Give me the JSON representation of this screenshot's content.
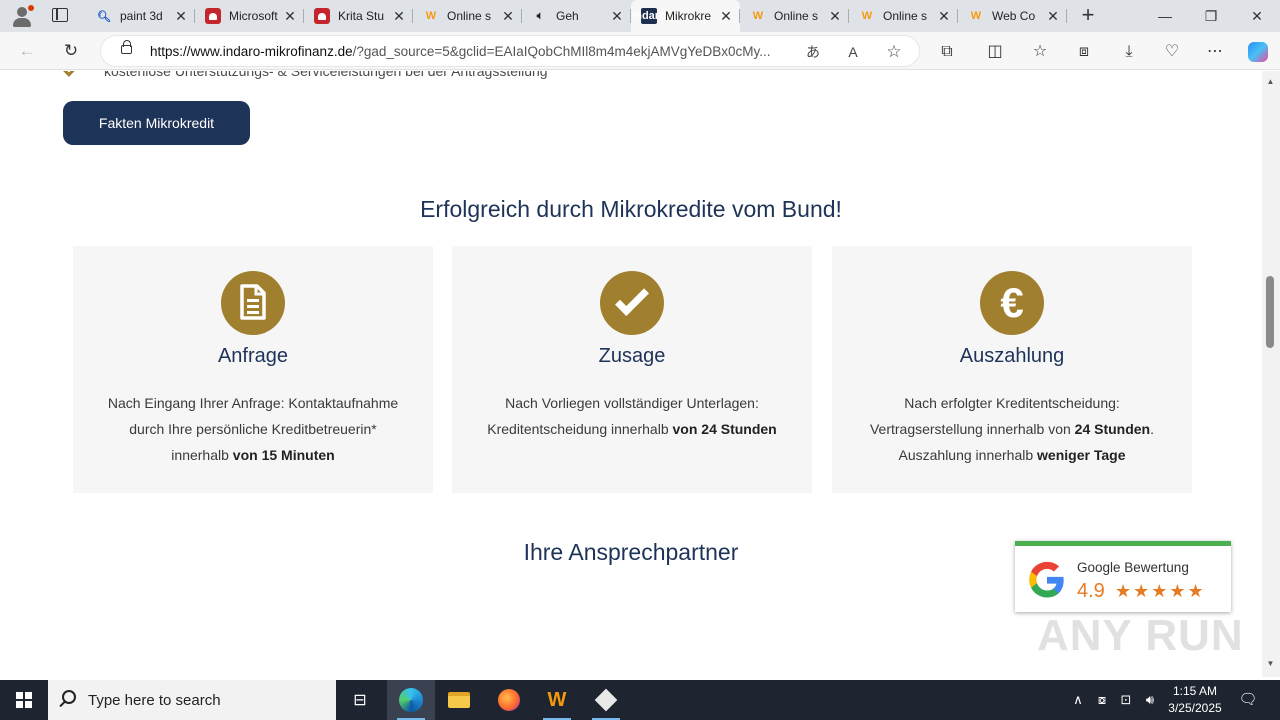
{
  "browser": {
    "tabs": [
      {
        "label": "paint 3d",
        "icon": "search-icon"
      },
      {
        "label": "Microsoft",
        "icon": "app-icon"
      },
      {
        "label": "Krita Stu",
        "icon": "app-icon"
      },
      {
        "label": "Online s",
        "icon": "wix-icon"
      },
      {
        "label": "Geh",
        "icon": "speaker-icon"
      },
      {
        "label": "Mikrokre",
        "icon": "indaro-icon",
        "active": true
      },
      {
        "label": "Online s",
        "icon": "wix-icon"
      },
      {
        "label": "Online s",
        "icon": "wix-icon"
      },
      {
        "label": "Web Co",
        "icon": "wix-icon"
      }
    ],
    "url_domain": "https://www.indaro-mikrofinanz.de",
    "url_rest": "/?gad_source=5&gclid=EAIaIQobChMIl8m4m4ekjAMVgYeDBx0cMy...",
    "favicon_label": "indaro"
  },
  "page": {
    "check_item": "kostenlose Unterstützungs- & Serviceleistungen bei der Antragsstellung",
    "facts_button": "Fakten Mikrokredit",
    "section_title": "Erfolgreich durch Mikrokredite vom Bund!",
    "cards": [
      {
        "title": "Anfrage",
        "icon": "document-icon",
        "line1": "Nach Eingang Ihrer Anfrage: Kontaktaufnahme",
        "line2": "durch Ihre persönliche Kreditbetreuerin*",
        "line3_pre": "innerhalb ",
        "line3_bold": "von 15 Minuten"
      },
      {
        "title": "Zusage",
        "icon": "checkmark-icon",
        "line1": "Nach Vorliegen vollständiger Unterlagen:",
        "line2_pre": "Kreditentscheidung innerhalb ",
        "line2_bold": "von 24 Stunden"
      },
      {
        "title": "Auszahlung",
        "icon": "euro-icon",
        "euro_symbol": "€",
        "line1": "Nach erfolgter Kreditentscheidung:",
        "line2_pre": "Vertragserstellung innerhalb von ",
        "line2_bold": "24 Stunden",
        "line2_post": ".",
        "line3_pre": "Auszahlung innerhalb ",
        "line3_bold": "weniger Tage"
      }
    ],
    "contacts_title": "Ihre Ansprechpartner",
    "google_widget": {
      "title": "Google Bewertung",
      "rating": "4.9",
      "stars": "★★★★★",
      "stars_shown": 4.5,
      "accent": "#e57c23"
    },
    "watermark": "ANY RUN",
    "colors": {
      "navy": "#1e3358",
      "gold": "#a07f2f",
      "card_bg": "#f6f6f7"
    }
  },
  "taskbar": {
    "search_placeholder": "Type here to search",
    "time": "1:15 AM",
    "date": "3/25/2025"
  }
}
